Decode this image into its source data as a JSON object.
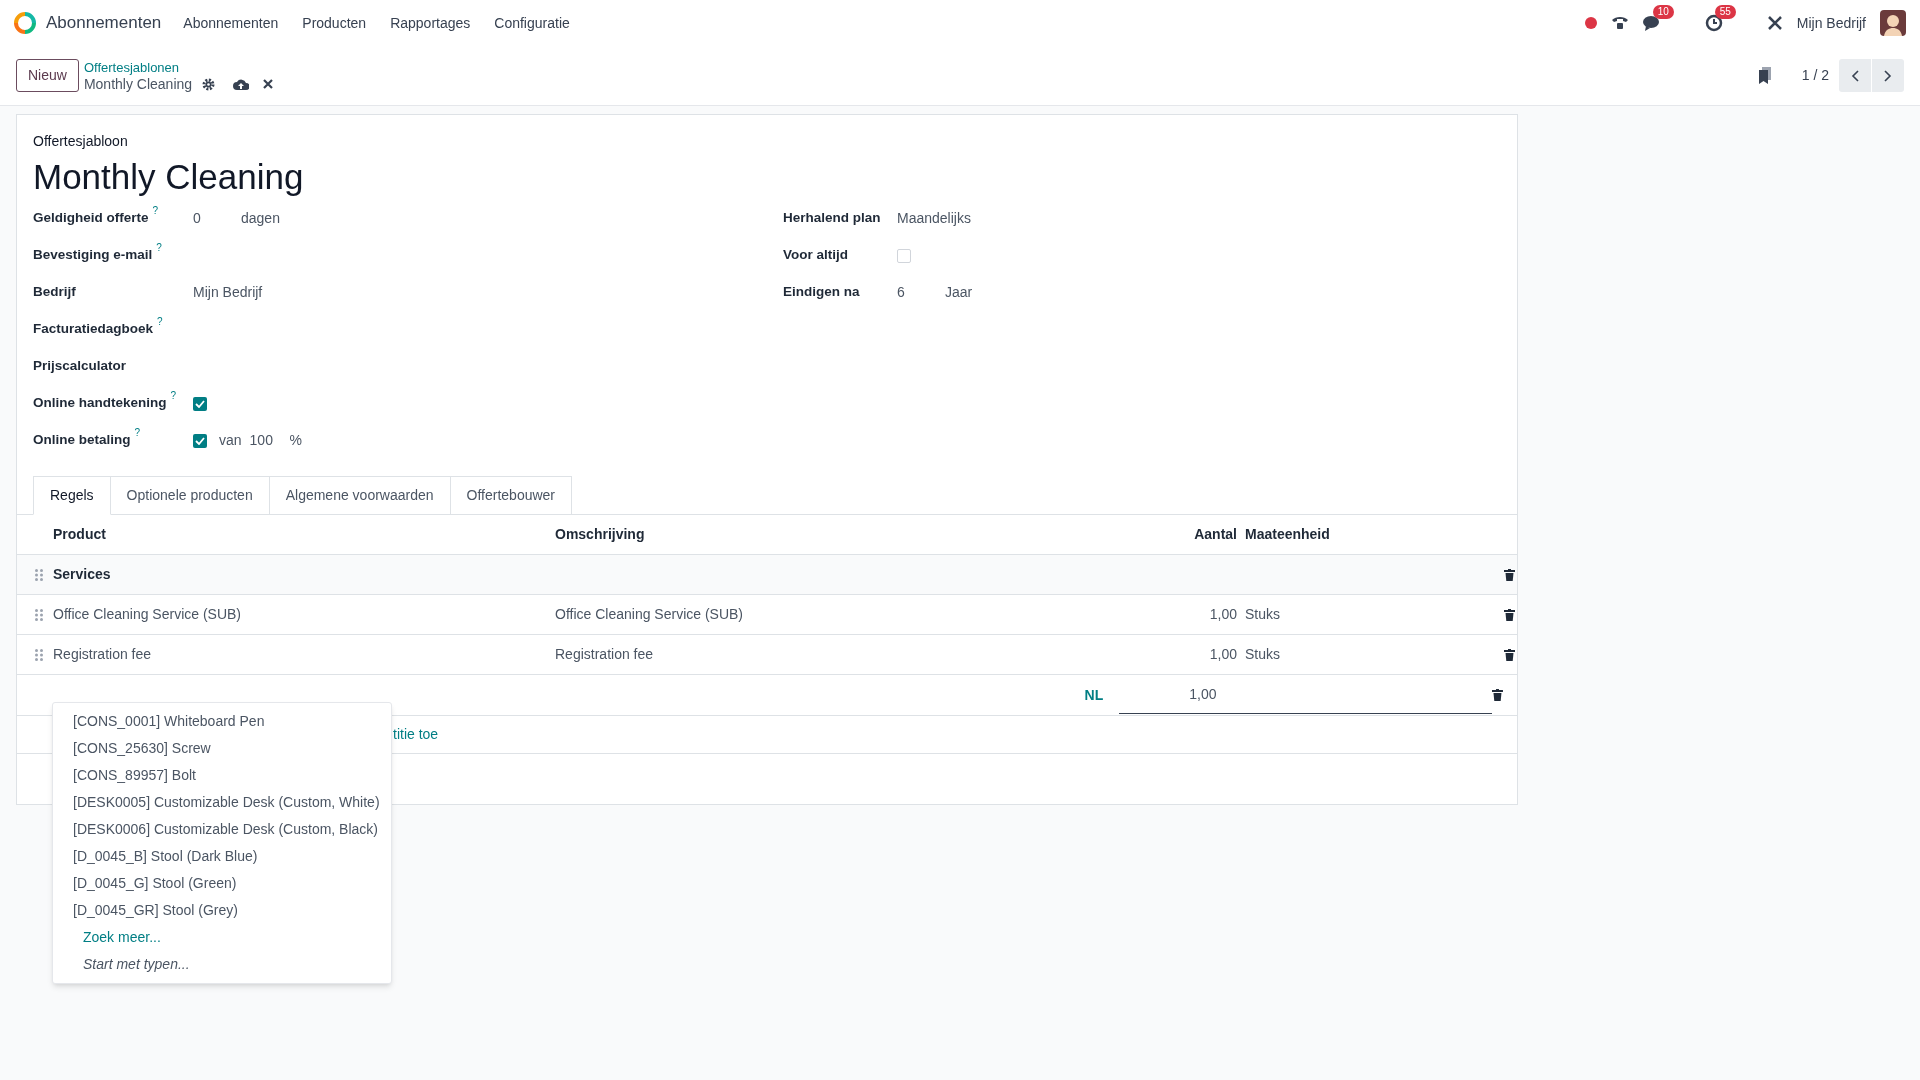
{
  "app": {
    "name": "Abonnementen"
  },
  "menu": [
    {
      "label": "Abonnementen"
    },
    {
      "label": "Producten"
    },
    {
      "label": "Rapportages"
    },
    {
      "label": "Configuratie"
    }
  ],
  "systray": {
    "chat_count": "10",
    "activity_count": "55",
    "company": "Mijn Bedrijf"
  },
  "control_panel": {
    "new_button": "Nieuw",
    "breadcrumb": "Offertesjablonen",
    "record": "Monthly Cleaning",
    "pager": "1 / 2"
  },
  "form": {
    "caption": "Offertesjabloon",
    "title": "Monthly Cleaning",
    "left_fields": [
      {
        "kind": "value_unit",
        "label": "Geldigheid offerte",
        "help": "?",
        "value": "0",
        "unit": "dagen"
      },
      {
        "kind": "empty",
        "label": "Bevestiging e-mail",
        "help": "?"
      },
      {
        "kind": "text",
        "label": "Bedrijf",
        "value": "Mijn Bedrijf"
      },
      {
        "kind": "empty",
        "label": "Facturatiedagboek",
        "help": "?"
      },
      {
        "kind": "empty",
        "label": "Prijscalculator"
      },
      {
        "kind": "checkbox",
        "label": "Online handtekening",
        "help": "?",
        "checked": true
      },
      {
        "kind": "checkbox_amount",
        "label": "Online betaling",
        "help": "?",
        "checked": true,
        "prefix": "van",
        "value": "100",
        "unit": "%"
      }
    ],
    "right_fields": [
      {
        "kind": "text",
        "label": "Herhalend plan",
        "value": "Maandelijks"
      },
      {
        "kind": "checkbox",
        "label": "Voor altijd",
        "checked": false
      },
      {
        "kind": "value_unit",
        "label": "Eindigen na",
        "value": "6",
        "unit": "Jaar"
      }
    ]
  },
  "tabs": [
    {
      "label": "Regels",
      "selected": true
    },
    {
      "label": "Optionele producten",
      "selected": false
    },
    {
      "label": "Algemene voorwaarden",
      "selected": false
    },
    {
      "label": "Offertebouwer",
      "selected": false
    }
  ],
  "lines": {
    "columns": [
      "Product",
      "Omschrijving",
      "Aantal",
      "Maateenheid"
    ],
    "rows": [
      {
        "kind": "section",
        "product": "Services"
      },
      {
        "kind": "line",
        "product": "Office Cleaning Service (SUB)",
        "description": "Office Cleaning Service (SUB)",
        "quantity": "1,00",
        "uom": "Stuks"
      },
      {
        "kind": "line",
        "product": "Registration fee",
        "description": "Registration fee",
        "quantity": "1,00",
        "uom": "Stuks"
      }
    ],
    "edit_row": {
      "language": "NL",
      "quantity": "1,00"
    },
    "add_link": "titie toe"
  },
  "dropdown": {
    "items": [
      "[CONS_0001] Whiteboard Pen",
      "[CONS_25630] Screw",
      "[CONS_89957] Bolt",
      "[DESK0005] Customizable Desk (Custom, White)",
      "[DESK0006] Customizable Desk (Custom, Black)",
      "[D_0045_B] Stool (Dark Blue)",
      "[D_0045_G] Stool (Green)",
      "[D_0045_GR] Stool (Grey)"
    ],
    "search_more": "Zoek meer...",
    "hint": "Start met typen..."
  }
}
